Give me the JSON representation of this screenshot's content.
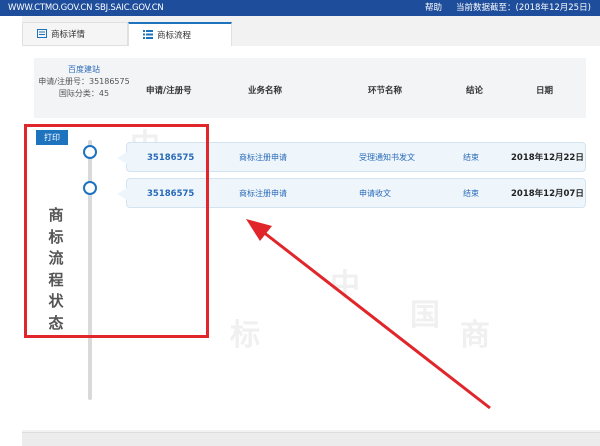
{
  "topbar": {
    "site": "WWW.CTMO.GOV.CN SBJ.SAIC.GOV.CN",
    "help": "帮助",
    "data_date": "当前数据截至：(2018年12月25日)"
  },
  "tabs": [
    {
      "label": "商标详情",
      "icon": "document-icon"
    },
    {
      "label": "商标流程",
      "icon": "list-icon"
    }
  ],
  "application": {
    "name": "百度建站",
    "number_line": "申请/注册号：35186575",
    "class_line": "国际分类：45"
  },
  "columns": [
    "申请/注册号",
    "业务名称",
    "环节名称",
    "结论",
    "日期"
  ],
  "print_label": "打印",
  "rows": [
    {
      "regno": "35186575",
      "business": "商标注册申请",
      "step": "受理通知书发文",
      "result": "结束",
      "date": "2018年12月22日"
    },
    {
      "regno": "35186575",
      "business": "商标注册申请",
      "step": "申请收文",
      "result": "结束",
      "date": "2018年12月07日"
    }
  ],
  "annotation": {
    "text": [
      "商",
      "标",
      "流",
      "程",
      "状",
      "态"
    ],
    "box_color": "#e1262b",
    "arrow_color": "#e1262b"
  },
  "colors": {
    "topbar": "#1d4d9b",
    "accent": "#1e73be"
  }
}
